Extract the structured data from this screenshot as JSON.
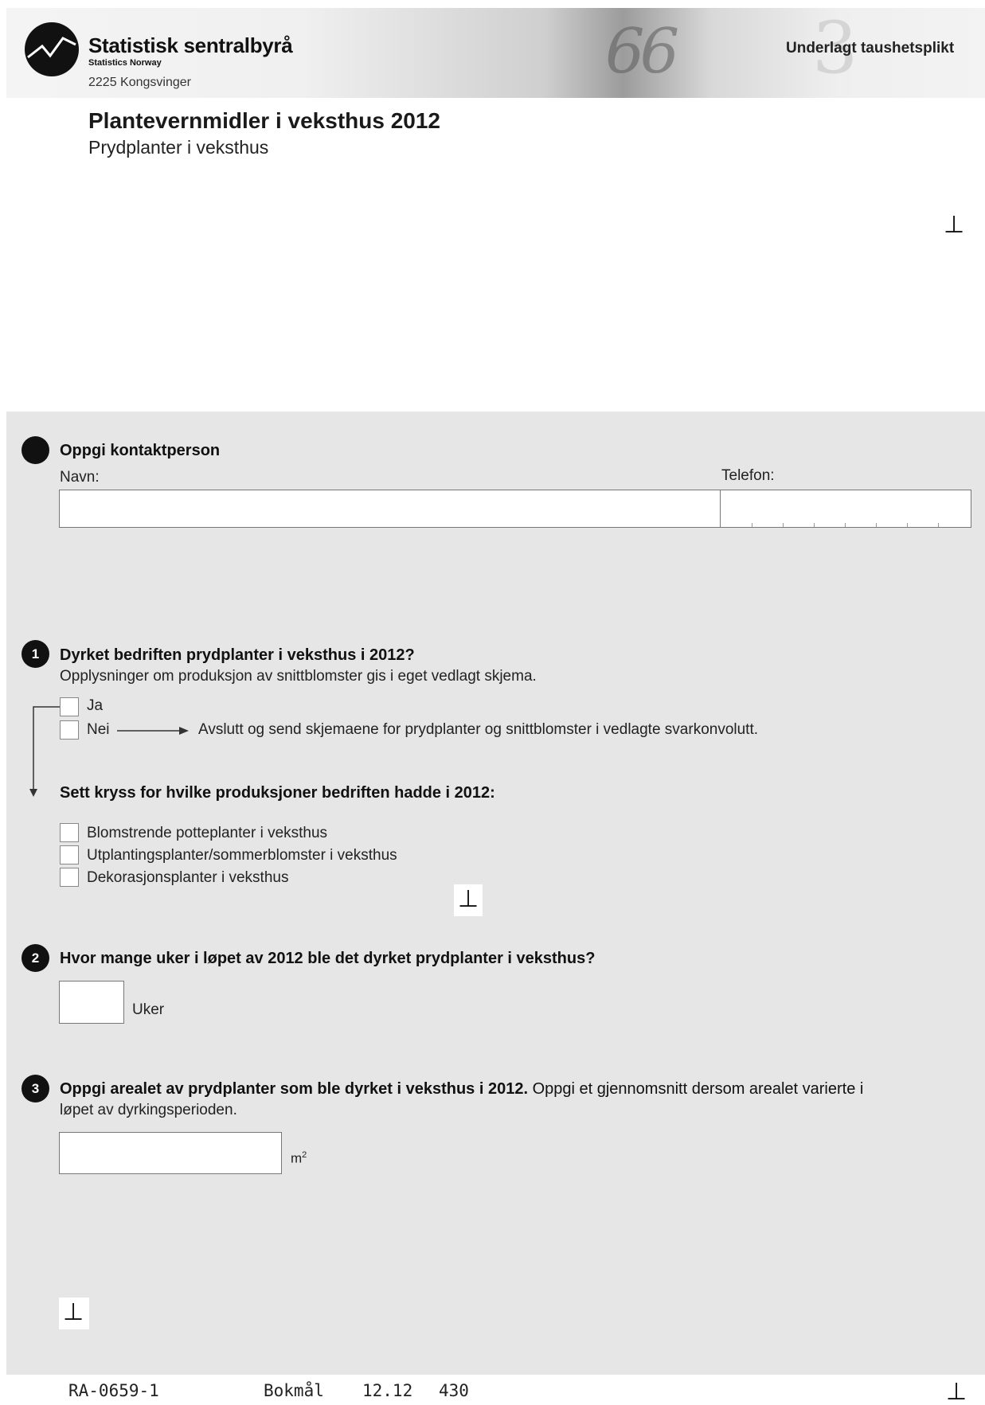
{
  "header": {
    "org_name": "Statistisk sentralbyrå",
    "org_name_en": "Statistics Norway",
    "city": "2225 Kongsvinger",
    "confidentiality": "Underlagt taushetsplikt",
    "banner_deco_text": "66",
    "banner_deco_text2": "3"
  },
  "form": {
    "title": "Plantevernmidler i veksthus 2012",
    "subtitle": "Prydplanter i veksthus"
  },
  "marks": {
    "t": "⊥"
  },
  "contact": {
    "heading": "Oppgi kontaktperson",
    "name_label": "Navn:",
    "phone_label": "Telefon:",
    "name_value": "",
    "phone_value": ""
  },
  "q1": {
    "number": "1",
    "heading": "Dyrket bedriften prydplanter i veksthus i 2012?",
    "note": "Opplysninger om produksjon av snittblomster gis i eget vedlagt skjema.",
    "options": [
      "Ja",
      "Nei"
    ],
    "nei_instruction": "Avslutt og send skjemaene for prydplanter og snittblomster i vedlagte svarkonvolutt.",
    "sub_heading": "Sett kryss for hvilke produksjoner bedriften hadde i 2012:",
    "productions": [
      "Blomstrende potteplanter i veksthus",
      "Utplantingsplanter/sommerblomster i veksthus",
      "Dekorasjonsplanter i veksthus"
    ]
  },
  "q2": {
    "number": "2",
    "heading": "Hvor mange uker i løpet av 2012 ble det dyrket prydplanter i veksthus?",
    "unit": "Uker",
    "value": ""
  },
  "q3": {
    "number": "3",
    "heading_bold": "Oppgi arealet av prydplanter som ble dyrket i veksthus i 2012.",
    "heading_rest": " Oppgi et gjennomsnitt dersom arealet varierte i",
    "heading_line2": "løpet av dyrkingsperioden.",
    "unit": "m",
    "unit_sup": "2",
    "value": ""
  },
  "footer": {
    "form_code": "RA-0659-1",
    "language": "Bokmål",
    "date": "12.12",
    "number": "430"
  }
}
